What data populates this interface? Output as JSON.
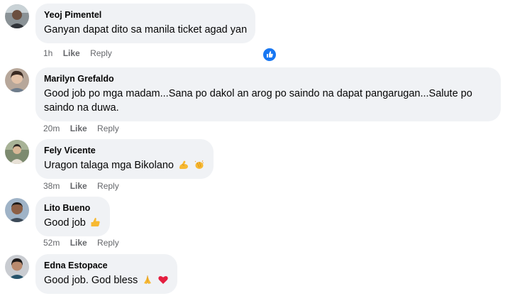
{
  "comments": [
    {
      "author": "Yeoj Pimentel",
      "text": "Ganyan dapat dito sa manila ticket agad yan",
      "time": "1h",
      "like": "Like",
      "reply": "Reply",
      "reaction_icon": "thumbs-up-icon"
    },
    {
      "author": "Marilyn Grefaldo",
      "text": "Good job po mga madam...Sana po dakol an arog po saindo na dapat pangarugan...Salute po saindo na duwa.",
      "time": "20m",
      "like": "Like",
      "reply": "Reply"
    },
    {
      "author": "Fely Vicente",
      "text": "Uragon talaga mga Bikolano",
      "emojis": [
        "flexed-biceps-emoji",
        "clapping-hands-emoji"
      ],
      "time": "38m",
      "like": "Like",
      "reply": "Reply"
    },
    {
      "author": "Lito Bueno",
      "text": "Good job",
      "emojis": [
        "thumbs-up-emoji"
      ],
      "time": "52m",
      "like": "Like",
      "reply": "Reply"
    },
    {
      "author": "Edna Estopace",
      "text": "Good job. God bless",
      "emojis": [
        "folded-hands-emoji",
        "red-heart-emoji"
      ],
      "time": "",
      "like": "",
      "reply": ""
    }
  ],
  "colors": {
    "bubble": "#f0f2f5",
    "meta_text": "#65676b",
    "reaction_blue": "#1877f2",
    "heart_red": "#e41e3f"
  }
}
